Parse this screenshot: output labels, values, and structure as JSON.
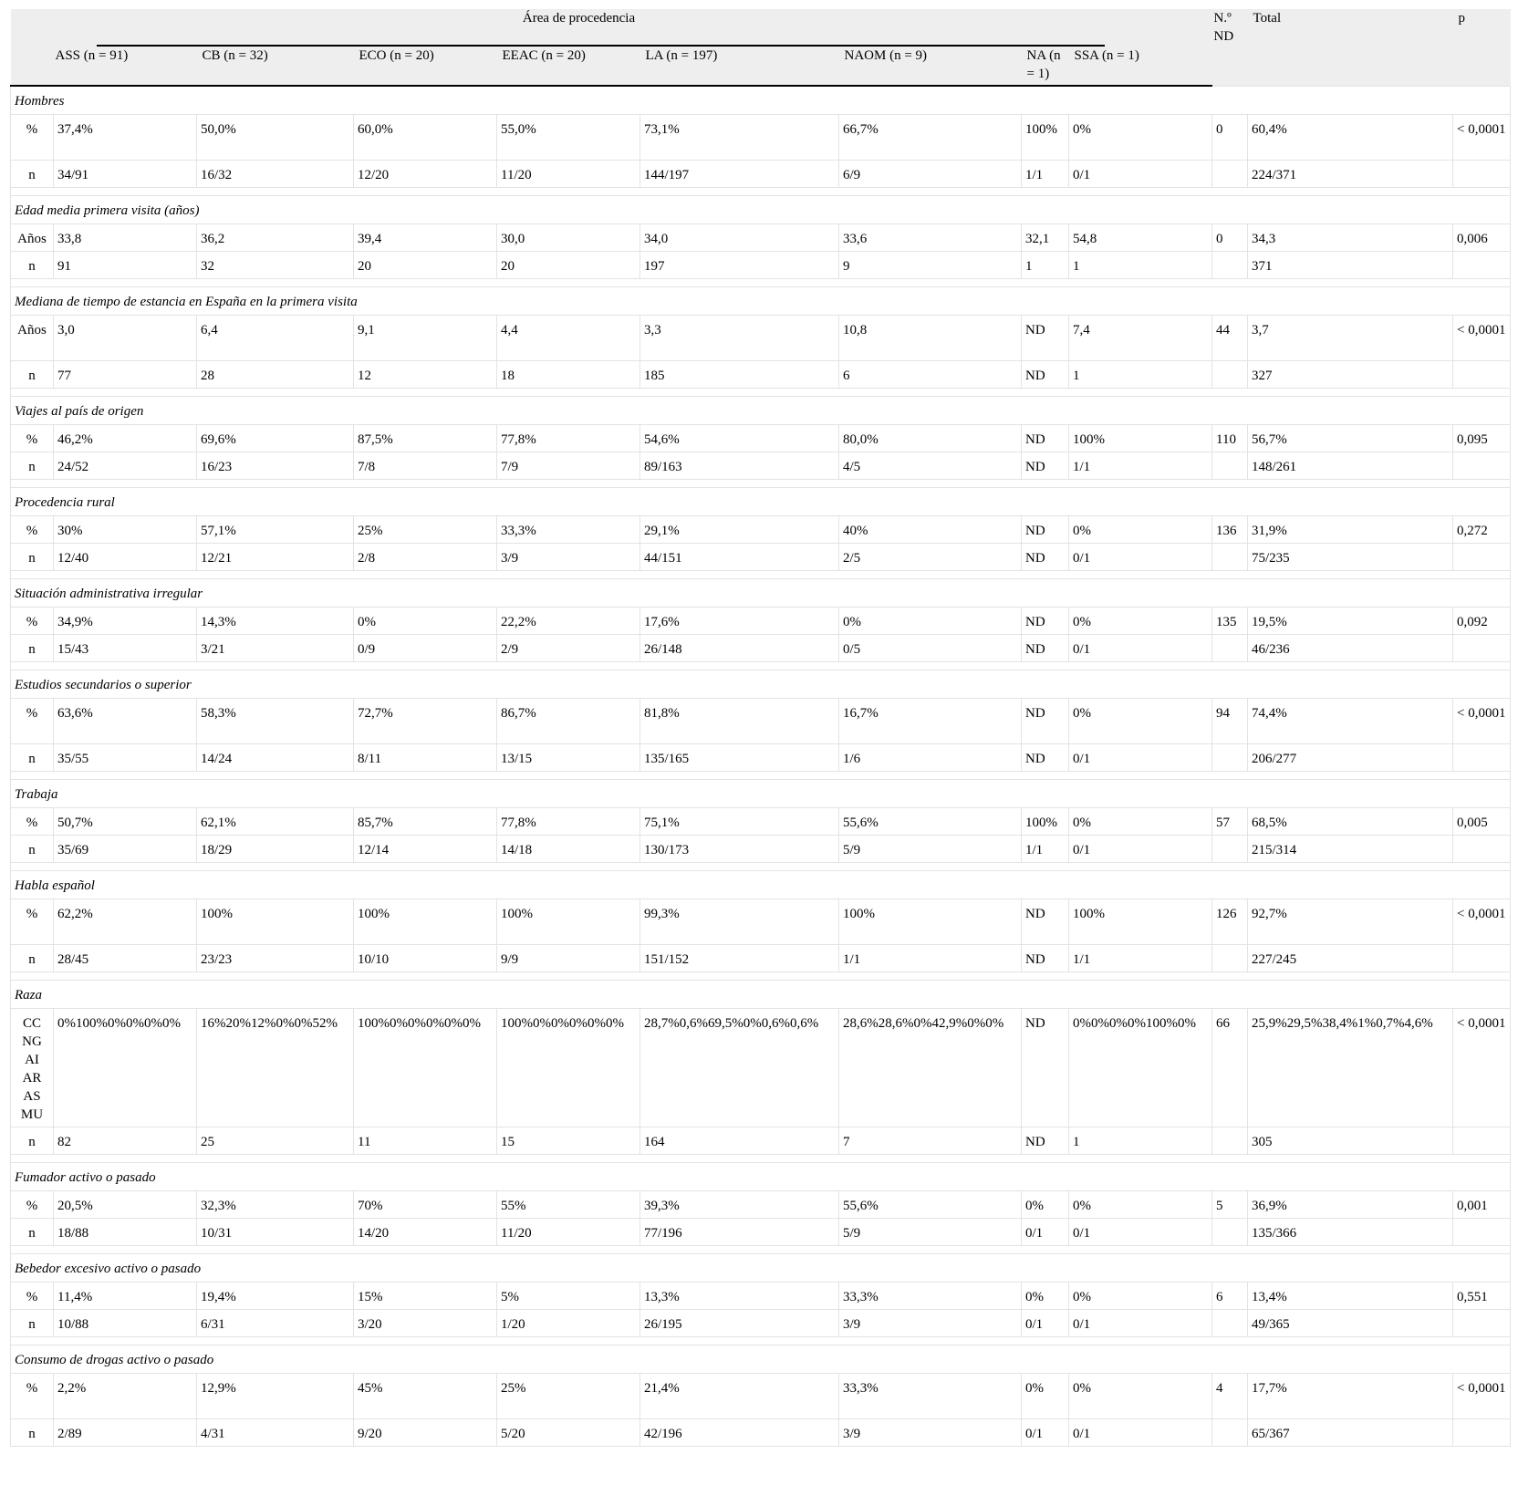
{
  "header": {
    "area_label": "Área de procedencia",
    "nd_label": "N.º ND",
    "total_label": "Total",
    "p_label": "p",
    "columns": [
      "ASS (n = 91)",
      "CB (n = 32)",
      "ECO (n = 20)",
      "EEAC (n = 20)",
      "LA (n = 197)",
      "NAOM (n = 9)",
      "NA (n = 1)",
      "SSA (n = 1)"
    ]
  },
  "sections": [
    {
      "title": "Hombres",
      "rows": [
        {
          "label": "%",
          "values": [
            "37,4%",
            "50,0%",
            "60,0%",
            "55,0%",
            "73,1%",
            "66,7%",
            "100%",
            "0%"
          ],
          "nd": "0",
          "total": "60,4%",
          "p": "< 0,0001"
        },
        {
          "label": "n",
          "values": [
            "34/91",
            "16/32",
            "12/20",
            "11/20",
            "144/197",
            "6/9",
            "1/1",
            "0/1"
          ],
          "nd": "",
          "total": "224/371",
          "p": ""
        }
      ]
    },
    {
      "title": "Edad media primera visita (años)",
      "rows": [
        {
          "label": "Años",
          "values": [
            "33,8",
            "36,2",
            "39,4",
            "30,0",
            "34,0",
            "33,6",
            "32,1",
            "54,8"
          ],
          "nd": "0",
          "total": "34,3",
          "p": "0,006"
        },
        {
          "label": "n",
          "values": [
            "91",
            "32",
            "20",
            "20",
            "197",
            "9",
            "1",
            "1"
          ],
          "nd": "",
          "total": "371",
          "p": ""
        }
      ]
    },
    {
      "title": "Mediana de tiempo de estancia en España en la primera visita",
      "rows": [
        {
          "label": "Años",
          "values": [
            "3,0",
            "6,4",
            "9,1",
            "4,4",
            "3,3",
            "10,8",
            "ND",
            "7,4"
          ],
          "nd": "44",
          "total": "3,7",
          "p": "< 0,0001"
        },
        {
          "label": "n",
          "values": [
            "77",
            "28",
            "12",
            "18",
            "185",
            "6",
            "ND",
            "1"
          ],
          "nd": "",
          "total": "327",
          "p": ""
        }
      ]
    },
    {
      "title": "Viajes al país de origen",
      "rows": [
        {
          "label": "%",
          "values": [
            "46,2%",
            "69,6%",
            "87,5%",
            "77,8%",
            "54,6%",
            "80,0%",
            "ND",
            "100%"
          ],
          "nd": "110",
          "total": "56,7%",
          "p": "0,095"
        },
        {
          "label": "n",
          "values": [
            "24/52",
            "16/23",
            "7/8",
            "7/9",
            "89/163",
            "4/5",
            "ND",
            "1/1"
          ],
          "nd": "",
          "total": "148/261",
          "p": ""
        }
      ]
    },
    {
      "title": "Procedencia rural",
      "rows": [
        {
          "label": "%",
          "values": [
            "30%",
            "57,1%",
            "25%",
            "33,3%",
            "29,1%",
            "40%",
            "ND",
            "0%"
          ],
          "nd": "136",
          "total": "31,9%",
          "p": "0,272"
        },
        {
          "label": "n",
          "values": [
            "12/40",
            "12/21",
            "2/8",
            "3/9",
            "44/151",
            "2/5",
            "ND",
            "0/1"
          ],
          "nd": "",
          "total": "75/235",
          "p": ""
        }
      ]
    },
    {
      "title": "Situación administrativa irregular",
      "rows": [
        {
          "label": "%",
          "values": [
            "34,9%",
            "14,3%",
            "0%",
            "22,2%",
            "17,6%",
            "0%",
            "ND",
            "0%"
          ],
          "nd": "135",
          "total": "19,5%",
          "p": "0,092"
        },
        {
          "label": "n",
          "values": [
            "15/43",
            "3/21",
            "0/9",
            "2/9",
            "26/148",
            "0/5",
            "ND",
            "0/1"
          ],
          "nd": "",
          "total": "46/236",
          "p": ""
        }
      ]
    },
    {
      "title": "Estudios secundarios o superior",
      "rows": [
        {
          "label": "%",
          "values": [
            "63,6%",
            "58,3%",
            "72,7%",
            "86,7%",
            "81,8%",
            "16,7%",
            "ND",
            "0%"
          ],
          "nd": "94",
          "total": "74,4%",
          "p": "< 0,0001"
        },
        {
          "label": "n",
          "values": [
            "35/55",
            "14/24",
            "8/11",
            "13/15",
            "135/165",
            "1/6",
            "ND",
            "0/1"
          ],
          "nd": "",
          "total": "206/277",
          "p": ""
        }
      ]
    },
    {
      "title": "Trabaja",
      "rows": [
        {
          "label": "%",
          "values": [
            "50,7%",
            "62,1%",
            "85,7%",
            "77,8%",
            "75,1%",
            "55,6%",
            "100%",
            "0%"
          ],
          "nd": "57",
          "total": "68,5%",
          "p": "0,005"
        },
        {
          "label": "n",
          "values": [
            "35/69",
            "18/29",
            "12/14",
            "14/18",
            "130/173",
            "5/9",
            "1/1",
            "0/1"
          ],
          "nd": "",
          "total": "215/314",
          "p": ""
        }
      ]
    },
    {
      "title": "Habla español",
      "rows": [
        {
          "label": "%",
          "values": [
            "62,2%",
            "100%",
            "100%",
            "100%",
            "99,3%",
            "100%",
            "ND",
            "100%"
          ],
          "nd": "126",
          "total": "92,7%",
          "p": "< 0,0001"
        },
        {
          "label": "n",
          "values": [
            "28/45",
            "23/23",
            "10/10",
            "9/9",
            "151/152",
            "1/1",
            "ND",
            "1/1"
          ],
          "nd": "",
          "total": "227/245",
          "p": ""
        }
      ]
    },
    {
      "title": "Raza",
      "rows": [
        {
          "label": "CC NG AI AR AS MU",
          "values": [
            "0%100%0%0%0%0%",
            "16%20%12%0%0%52%",
            "100%0%0%0%0%0%",
            "100%0%0%0%0%0%",
            "28,7%0,6%69,5%0%0,6%0,6%",
            "28,6%28,6%0%42,9%0%0%",
            "ND",
            "0%0%0%0%100%0%"
          ],
          "nd": "66",
          "total": "25,9%29,5%38,4%1%0,7%4,6%",
          "p": "< 0,0001"
        },
        {
          "label": "n",
          "values": [
            "82",
            "25",
            "11",
            "15",
            "164",
            "7",
            "ND",
            "1"
          ],
          "nd": "",
          "total": "305",
          "p": ""
        }
      ]
    },
    {
      "title": "Fumador activo o pasado",
      "rows": [
        {
          "label": "%",
          "values": [
            "20,5%",
            "32,3%",
            "70%",
            "55%",
            "39,3%",
            "55,6%",
            "0%",
            "0%"
          ],
          "nd": "5",
          "total": "36,9%",
          "p": "0,001"
        },
        {
          "label": "n",
          "values": [
            "18/88",
            "10/31",
            "14/20",
            "11/20",
            "77/196",
            "5/9",
            "0/1",
            "0/1"
          ],
          "nd": "",
          "total": "135/366",
          "p": ""
        }
      ]
    },
    {
      "title": "Bebedor excesivo activo o pasado",
      "rows": [
        {
          "label": "%",
          "values": [
            "11,4%",
            "19,4%",
            "15%",
            "5%",
            "13,3%",
            "33,3%",
            "0%",
            "0%"
          ],
          "nd": "6",
          "total": "13,4%",
          "p": "0,551"
        },
        {
          "label": "n",
          "values": [
            "10/88",
            "6/31",
            "3/20",
            "1/20",
            "26/195",
            "3/9",
            "0/1",
            "0/1"
          ],
          "nd": "",
          "total": "49/365",
          "p": ""
        }
      ]
    },
    {
      "title": "Consumo de drogas activo o pasado",
      "rows": [
        {
          "label": "%",
          "values": [
            "2,2%",
            "12,9%",
            "45%",
            "25%",
            "21,4%",
            "33,3%",
            "0%",
            "0%"
          ],
          "nd": "4",
          "total": "17,7%",
          "p": "< 0,0001"
        },
        {
          "label": "n",
          "values": [
            "2/89",
            "4/31",
            "9/20",
            "5/20",
            "42/196",
            "3/9",
            "0/1",
            "0/1"
          ],
          "nd": "",
          "total": "65/367",
          "p": ""
        }
      ]
    }
  ]
}
